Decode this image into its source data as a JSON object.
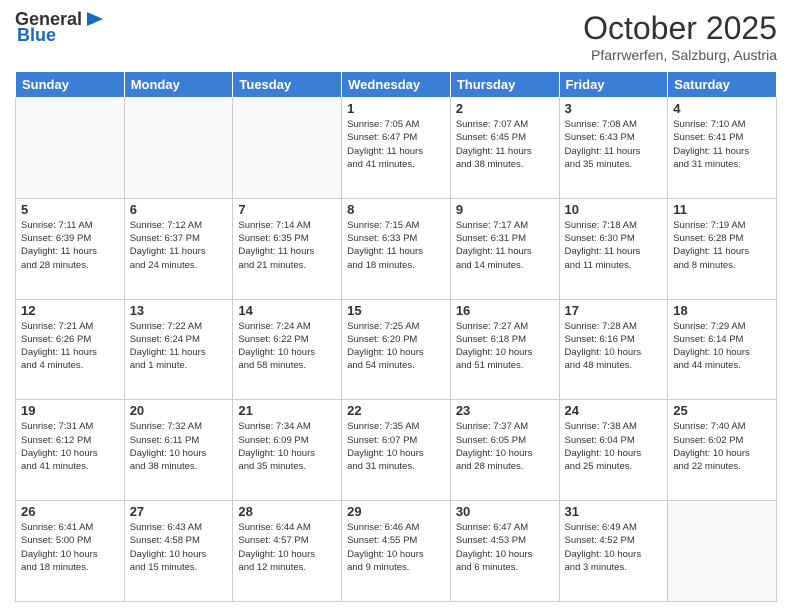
{
  "header": {
    "logo_general": "General",
    "logo_blue": "Blue",
    "month_title": "October 2025",
    "subtitle": "Pfarrwerfen, Salzburg, Austria"
  },
  "weekdays": [
    "Sunday",
    "Monday",
    "Tuesday",
    "Wednesday",
    "Thursday",
    "Friday",
    "Saturday"
  ],
  "weeks": [
    [
      {
        "day": "",
        "info": ""
      },
      {
        "day": "",
        "info": ""
      },
      {
        "day": "",
        "info": ""
      },
      {
        "day": "1",
        "info": "Sunrise: 7:05 AM\nSunset: 6:47 PM\nDaylight: 11 hours\nand 41 minutes."
      },
      {
        "day": "2",
        "info": "Sunrise: 7:07 AM\nSunset: 6:45 PM\nDaylight: 11 hours\nand 38 minutes."
      },
      {
        "day": "3",
        "info": "Sunrise: 7:08 AM\nSunset: 6:43 PM\nDaylight: 11 hours\nand 35 minutes."
      },
      {
        "day": "4",
        "info": "Sunrise: 7:10 AM\nSunset: 6:41 PM\nDaylight: 11 hours\nand 31 minutes."
      }
    ],
    [
      {
        "day": "5",
        "info": "Sunrise: 7:11 AM\nSunset: 6:39 PM\nDaylight: 11 hours\nand 28 minutes."
      },
      {
        "day": "6",
        "info": "Sunrise: 7:12 AM\nSunset: 6:37 PM\nDaylight: 11 hours\nand 24 minutes."
      },
      {
        "day": "7",
        "info": "Sunrise: 7:14 AM\nSunset: 6:35 PM\nDaylight: 11 hours\nand 21 minutes."
      },
      {
        "day": "8",
        "info": "Sunrise: 7:15 AM\nSunset: 6:33 PM\nDaylight: 11 hours\nand 18 minutes."
      },
      {
        "day": "9",
        "info": "Sunrise: 7:17 AM\nSunset: 6:31 PM\nDaylight: 11 hours\nand 14 minutes."
      },
      {
        "day": "10",
        "info": "Sunrise: 7:18 AM\nSunset: 6:30 PM\nDaylight: 11 hours\nand 11 minutes."
      },
      {
        "day": "11",
        "info": "Sunrise: 7:19 AM\nSunset: 6:28 PM\nDaylight: 11 hours\nand 8 minutes."
      }
    ],
    [
      {
        "day": "12",
        "info": "Sunrise: 7:21 AM\nSunset: 6:26 PM\nDaylight: 11 hours\nand 4 minutes."
      },
      {
        "day": "13",
        "info": "Sunrise: 7:22 AM\nSunset: 6:24 PM\nDaylight: 11 hours\nand 1 minute."
      },
      {
        "day": "14",
        "info": "Sunrise: 7:24 AM\nSunset: 6:22 PM\nDaylight: 10 hours\nand 58 minutes."
      },
      {
        "day": "15",
        "info": "Sunrise: 7:25 AM\nSunset: 6:20 PM\nDaylight: 10 hours\nand 54 minutes."
      },
      {
        "day": "16",
        "info": "Sunrise: 7:27 AM\nSunset: 6:18 PM\nDaylight: 10 hours\nand 51 minutes."
      },
      {
        "day": "17",
        "info": "Sunrise: 7:28 AM\nSunset: 6:16 PM\nDaylight: 10 hours\nand 48 minutes."
      },
      {
        "day": "18",
        "info": "Sunrise: 7:29 AM\nSunset: 6:14 PM\nDaylight: 10 hours\nand 44 minutes."
      }
    ],
    [
      {
        "day": "19",
        "info": "Sunrise: 7:31 AM\nSunset: 6:12 PM\nDaylight: 10 hours\nand 41 minutes."
      },
      {
        "day": "20",
        "info": "Sunrise: 7:32 AM\nSunset: 6:11 PM\nDaylight: 10 hours\nand 38 minutes."
      },
      {
        "day": "21",
        "info": "Sunrise: 7:34 AM\nSunset: 6:09 PM\nDaylight: 10 hours\nand 35 minutes."
      },
      {
        "day": "22",
        "info": "Sunrise: 7:35 AM\nSunset: 6:07 PM\nDaylight: 10 hours\nand 31 minutes."
      },
      {
        "day": "23",
        "info": "Sunrise: 7:37 AM\nSunset: 6:05 PM\nDaylight: 10 hours\nand 28 minutes."
      },
      {
        "day": "24",
        "info": "Sunrise: 7:38 AM\nSunset: 6:04 PM\nDaylight: 10 hours\nand 25 minutes."
      },
      {
        "day": "25",
        "info": "Sunrise: 7:40 AM\nSunset: 6:02 PM\nDaylight: 10 hours\nand 22 minutes."
      }
    ],
    [
      {
        "day": "26",
        "info": "Sunrise: 6:41 AM\nSunset: 5:00 PM\nDaylight: 10 hours\nand 18 minutes."
      },
      {
        "day": "27",
        "info": "Sunrise: 6:43 AM\nSunset: 4:58 PM\nDaylight: 10 hours\nand 15 minutes."
      },
      {
        "day": "28",
        "info": "Sunrise: 6:44 AM\nSunset: 4:57 PM\nDaylight: 10 hours\nand 12 minutes."
      },
      {
        "day": "29",
        "info": "Sunrise: 6:46 AM\nSunset: 4:55 PM\nDaylight: 10 hours\nand 9 minutes."
      },
      {
        "day": "30",
        "info": "Sunrise: 6:47 AM\nSunset: 4:53 PM\nDaylight: 10 hours\nand 6 minutes."
      },
      {
        "day": "31",
        "info": "Sunrise: 6:49 AM\nSunset: 4:52 PM\nDaylight: 10 hours\nand 3 minutes."
      },
      {
        "day": "",
        "info": ""
      }
    ]
  ]
}
